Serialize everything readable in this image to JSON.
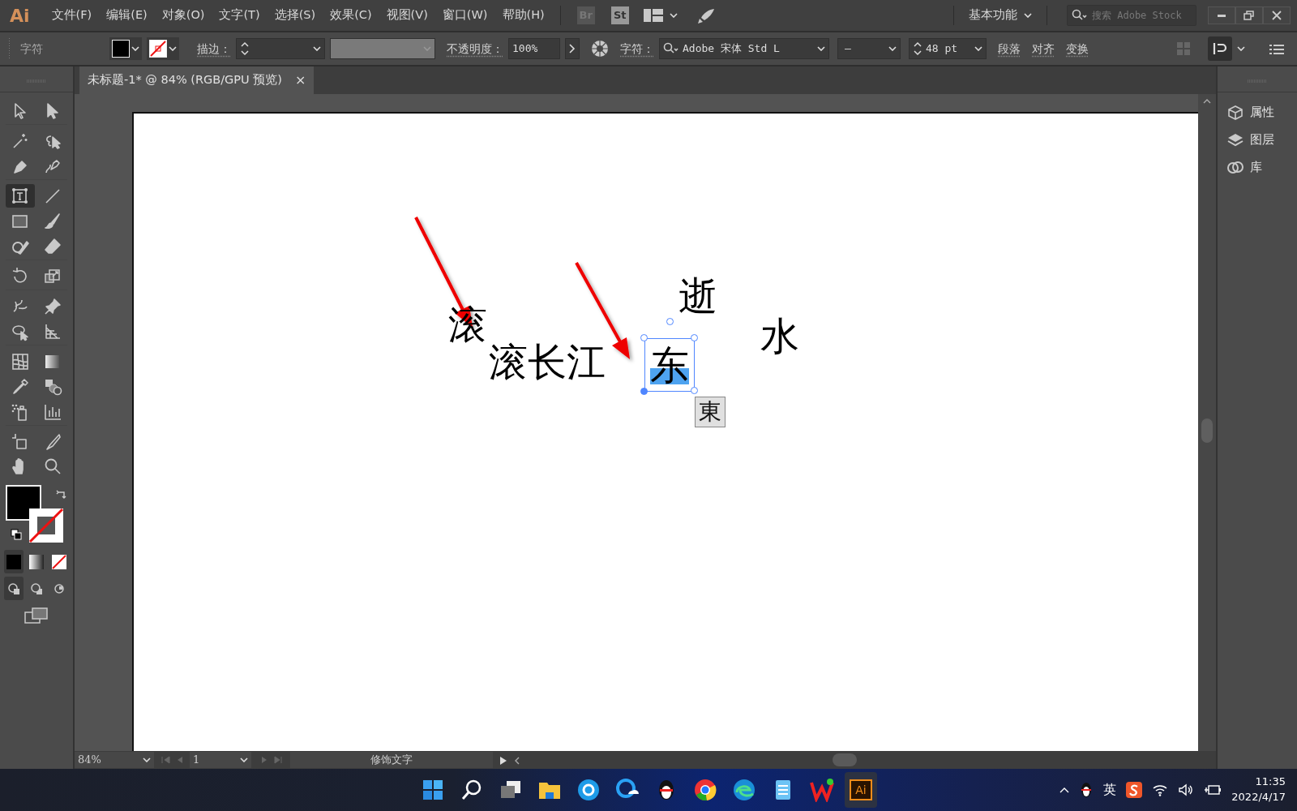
{
  "menubar": {
    "logo": "Ai",
    "menus": [
      "文件(F)",
      "编辑(E)",
      "对象(O)",
      "文字(T)",
      "选择(S)",
      "效果(C)",
      "视图(V)",
      "窗口(W)",
      "帮助(H)"
    ],
    "bridge": "Br",
    "stock": "St",
    "workspace": "基本功能",
    "search": {
      "placeholder": "搜索 Adobe Stock"
    }
  },
  "control_bar": {
    "title": "字符",
    "stroke_label": "描边：",
    "opacity_label": "不透明度：",
    "opacity": "100%",
    "character_label": "字符：",
    "font_family": "Adobe 宋体 Std L",
    "font_style": "–",
    "font_size": "48 pt",
    "links": [
      "段落",
      "对齐",
      "变换"
    ]
  },
  "document_tab": {
    "title": "未标题-1* @ 84% (RGB/GPU 预览)",
    "close": "×"
  },
  "tools": [
    {
      "selected": false
    },
    {
      "selected": false
    },
    {
      "selected": false
    },
    {
      "selected": false
    },
    {
      "selected": false
    },
    {
      "selected": false
    },
    {
      "selected": true
    },
    {
      "selected": false
    },
    {
      "selected": false
    },
    {
      "selected": false
    },
    {
      "selected": false
    },
    {
      "selected": false
    },
    {
      "selected": false
    },
    {
      "selected": false
    },
    {
      "selected": false
    },
    {
      "selected": false
    },
    {
      "selected": false
    },
    {
      "selected": false
    },
    {
      "selected": false
    },
    {
      "selected": false
    },
    {
      "selected": false
    },
    {
      "selected": false
    },
    {
      "selected": false
    },
    {
      "selected": false
    },
    {
      "selected": false
    },
    {
      "selected": false
    },
    {
      "selected": false
    },
    {
      "selected": false
    }
  ],
  "artboard": {
    "texts": [
      {
        "text": "滚",
        "selected": false
      },
      {
        "text": "滚长江",
        "selected": false
      },
      {
        "text": "东",
        "selected": true
      },
      {
        "text": "逝",
        "selected": false
      },
      {
        "text": "水",
        "selected": false
      }
    ],
    "ime_candidate": "東"
  },
  "panels": [
    {
      "label": "属性"
    },
    {
      "label": "图层"
    },
    {
      "label": "库"
    }
  ],
  "status_bar": {
    "zoom": "84%",
    "artboard": "1",
    "tool": "修饰文字"
  },
  "taskbar": {
    "app_label": "Ai",
    "input_method": "英",
    "time": "11:35",
    "date": "2022/4/17"
  }
}
